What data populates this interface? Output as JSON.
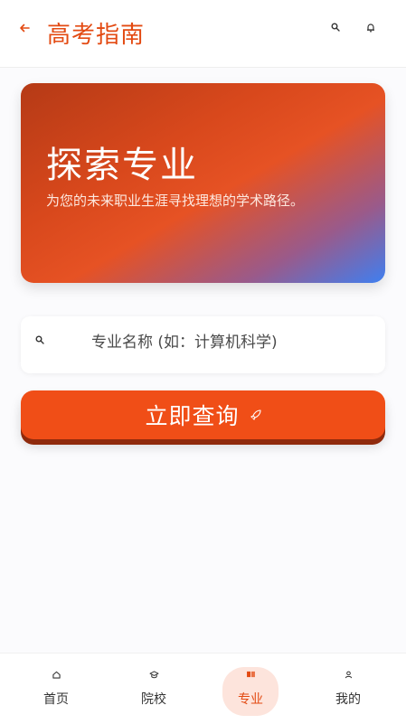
{
  "header": {
    "title": "高考指南",
    "back_icon": "arrow-left-icon",
    "search_icon": "search-icon",
    "notification_icon": "bell-icon"
  },
  "hero": {
    "title": "探索专业",
    "subtitle": "为您的未来职业生涯寻找理想的学术路径。"
  },
  "search": {
    "placeholder": "专业名称 (如：计算机科学)",
    "value": ""
  },
  "query_button": {
    "label": "立即查询",
    "icon": "rocket-icon"
  },
  "bottom_nav": {
    "items": [
      {
        "label": "首页",
        "icon": "home-icon"
      },
      {
        "label": "院校",
        "icon": "school-icon"
      },
      {
        "label": "专业",
        "icon": "book-icon"
      },
      {
        "label": "我的",
        "icon": "person-icon"
      }
    ],
    "active": "专业"
  },
  "colors": {
    "accent": "#e34a12",
    "button": "#f04e17",
    "active_nav_bg": "#fde4dc"
  }
}
